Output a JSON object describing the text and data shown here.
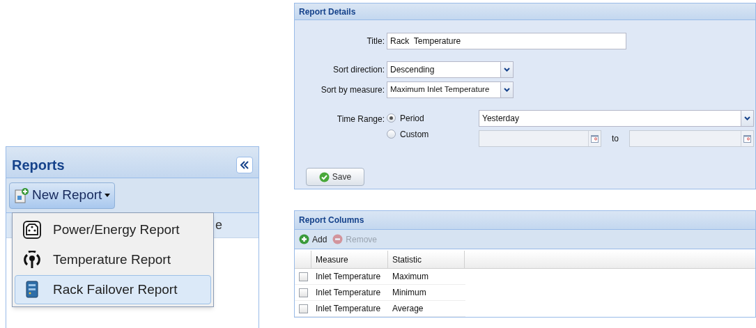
{
  "reports_panel": {
    "title": "Reports",
    "new_report_button": "New Report",
    "hidden_header_fragment": "e",
    "menu": [
      {
        "kind": "power",
        "label": "Power/Energy Report",
        "selected": false
      },
      {
        "kind": "temperature",
        "label": "Temperature Report",
        "selected": false
      },
      {
        "kind": "rack",
        "label": "Rack Failover Report",
        "selected": true
      }
    ]
  },
  "report_details": {
    "title": "Report Details",
    "title_label": "Title:",
    "title_value": "Rack  Temperature",
    "sort_direction_label": "Sort direction:",
    "sort_direction_value": "Descending",
    "sort_measure_label": "Sort by measure:",
    "sort_measure_value": "Maximum Inlet Temperature",
    "time_range_label": "Time Range:",
    "time_options": [
      {
        "label": "Period",
        "selected": true
      },
      {
        "label": "Custom",
        "selected": false
      }
    ],
    "period_value": "Yesterday",
    "date_from": {
      "disabled": true
    },
    "to_label": "to",
    "date_to": {
      "disabled": true
    },
    "save_button": "Save"
  },
  "report_columns": {
    "title": "Report Columns",
    "toolbar": [
      {
        "kind": "add",
        "label": "Add",
        "disabled": false
      },
      {
        "kind": "remove",
        "label": "Remove",
        "disabled": true
      }
    ],
    "columns": [
      "Measure",
      "Statistic"
    ],
    "rows": [
      {
        "checked": false,
        "cells": [
          "Inlet Temperature",
          "Maximum"
        ]
      },
      {
        "checked": false,
        "cells": [
          "Inlet Temperature",
          "Minimum"
        ]
      },
      {
        "checked": false,
        "cells": [
          "Inlet Temperature",
          "Average"
        ]
      }
    ]
  }
}
